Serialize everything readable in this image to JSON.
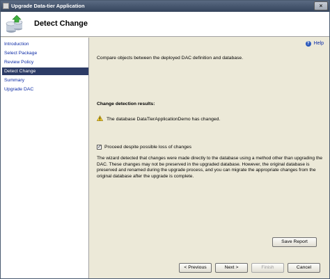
{
  "window": {
    "title": "Upgrade Data-tier Application",
    "close_label": "×"
  },
  "banner": {
    "heading": "Detect Change"
  },
  "sidebar": {
    "items": [
      {
        "label": "Introduction",
        "active": false
      },
      {
        "label": "Select Package",
        "active": false
      },
      {
        "label": "Review Policy",
        "active": false
      },
      {
        "label": "Detect Change",
        "active": true
      },
      {
        "label": "Summary",
        "active": false
      },
      {
        "label": "Upgrade DAC",
        "active": false
      }
    ]
  },
  "content": {
    "help_label": "Help",
    "description": "Compare objects between the deployed DAC definition and database.",
    "results_title": "Change detection results:",
    "warning_text": "The database DataTierApplicationDemo has changed.",
    "checkbox_label": "Proceed despite possible loss of changes",
    "checkbox_checked": true,
    "explanation": "The wizard detected that changes were made directly to the database using a method other than upgrading the DAC. These changes may not be preserved in the upgraded database. However, the original database is preserved and renamed during the upgrade process, and you can migrate the appropriate changes from the original database after the upgrade is complete.",
    "save_report_label": "Save Report"
  },
  "footer": {
    "previous_label": "< Previous",
    "next_label": "Next >",
    "finish_label": "Finish",
    "cancel_label": "Cancel"
  },
  "icons": {
    "warning": "warning-icon",
    "help": "help-icon",
    "wizard": "upgrade-wizard-icon"
  }
}
